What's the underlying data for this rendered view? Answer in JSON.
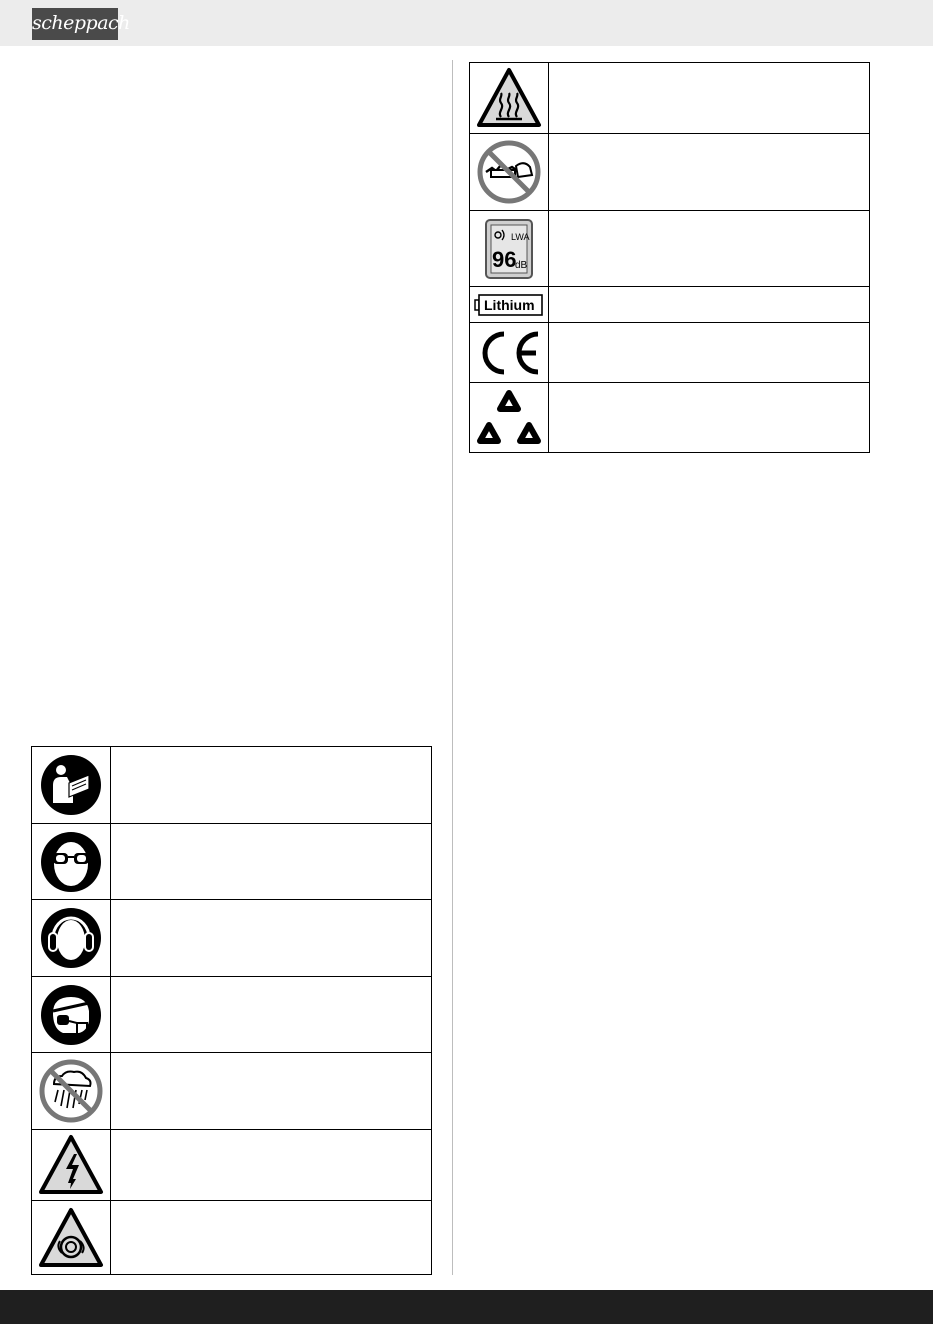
{
  "header": {
    "brand": "scheppach"
  },
  "right_symbols": [
    {
      "icon": "hot-surface-warning-icon",
      "text": ""
    },
    {
      "icon": "no-chain-saw-use-icon",
      "text": ""
    },
    {
      "icon": "sound-power-level-icon",
      "text": "",
      "sound_label": "LWA",
      "sound_value": "96",
      "sound_unit": "dB"
    },
    {
      "icon": "lithium-battery-icon",
      "text": "",
      "battery_label": "Lithium"
    },
    {
      "icon": "ce-mark-icon",
      "text": ""
    },
    {
      "icon": "recycling-triangle-icon",
      "text": ""
    }
  ],
  "left_symbols": [
    {
      "icon": "read-manual-icon",
      "text": ""
    },
    {
      "icon": "eye-protection-icon",
      "text": ""
    },
    {
      "icon": "ear-protection-icon",
      "text": ""
    },
    {
      "icon": "respiratory-protection-icon",
      "text": ""
    },
    {
      "icon": "no-rain-exposure-icon",
      "text": ""
    },
    {
      "icon": "electric-shock-warning-icon",
      "text": ""
    },
    {
      "icon": "rotating-parts-warning-icon",
      "text": ""
    }
  ],
  "colors": {
    "header_bg": "#ececec",
    "logo_bg": "#4a4a4a",
    "footer_bg": "#1f1f1f",
    "warning_fill": "#d9d9d9",
    "prohibit_red": "#777777"
  }
}
